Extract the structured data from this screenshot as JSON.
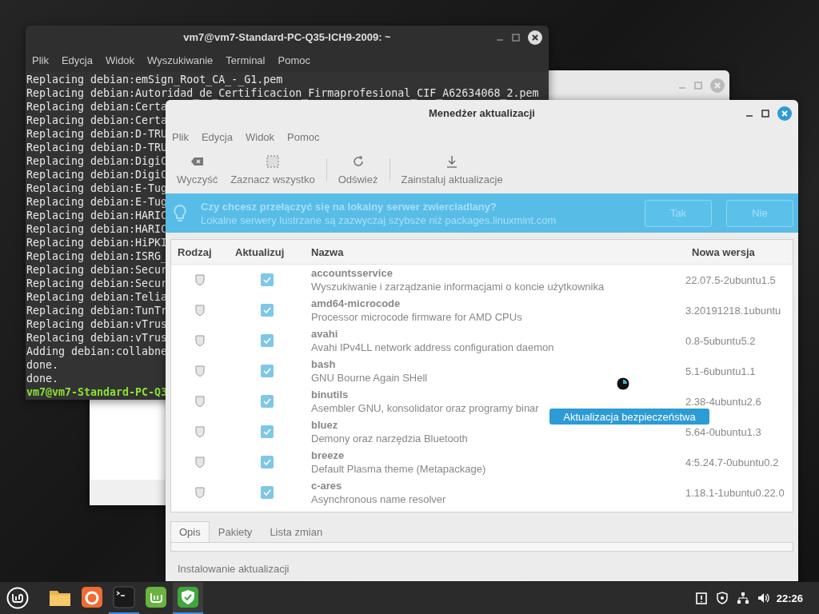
{
  "terminal": {
    "title": "vm7@vm7-Standard-PC-Q35-ICH9-2009: ~",
    "menu": [
      "Plik",
      "Edycja",
      "Widok",
      "Wyszukiwanie",
      "Terminal",
      "Pomoc"
    ],
    "lines": [
      {
        "kind": "output",
        "text": "Replacing debian:emSign_Root_CA_-_G1.pem"
      },
      {
        "kind": "output",
        "text": "Replacing debian:Autoridad_de_Certificacion_Firmaprofesional_CIF_A62634068_2.pem"
      },
      {
        "kind": "output",
        "text": "Replacing debian:Certa"
      },
      {
        "kind": "output",
        "text": "Replacing debian:Certa"
      },
      {
        "kind": "output",
        "text": "Replacing debian:D-TRU"
      },
      {
        "kind": "output",
        "text": "Replacing debian:D-TRU"
      },
      {
        "kind": "output",
        "text": "Replacing debian:DigiC"
      },
      {
        "kind": "output",
        "text": "Replacing debian:DigiC"
      },
      {
        "kind": "output",
        "text": "Replacing debian:E-Tug"
      },
      {
        "kind": "output",
        "text": "Replacing debian:E-Tug"
      },
      {
        "kind": "output",
        "text": "Replacing debian:HARIC"
      },
      {
        "kind": "output",
        "text": "Replacing debian:HARIC"
      },
      {
        "kind": "output",
        "text": "Replacing debian:HiPKI"
      },
      {
        "kind": "output",
        "text": "Replacing debian:ISRG_"
      },
      {
        "kind": "output",
        "text": "Replacing debian:Secur"
      },
      {
        "kind": "output",
        "text": "Replacing debian:Secur"
      },
      {
        "kind": "output",
        "text": "Replacing debian:Telia"
      },
      {
        "kind": "output",
        "text": "Replacing debian:TunTr"
      },
      {
        "kind": "output",
        "text": "Replacing debian:vTrus"
      },
      {
        "kind": "output",
        "text": "Replacing debian:vTrus"
      },
      {
        "kind": "output",
        "text": "Adding debian:collabne"
      },
      {
        "kind": "output",
        "text": "done."
      },
      {
        "kind": "output",
        "text": "done."
      },
      {
        "kind": "prompt",
        "text": "vm7@vm7-Standard-PC-Q3"
      }
    ]
  },
  "update_manager": {
    "title": "Menedżer aktualizacji",
    "menu": [
      "Plik",
      "Edycja",
      "Widok",
      "Pomoc"
    ],
    "toolbar": [
      [
        {
          "kind": "clear",
          "label": "Wyczyść"
        },
        {
          "kind": "select-all",
          "label": "Zaznacz wszystko"
        }
      ],
      [
        {
          "kind": "refresh",
          "label": "Odśwież"
        }
      ],
      [
        {
          "kind": "install",
          "label": "Zainstaluj aktualizacje"
        }
      ]
    ],
    "infobar": {
      "title": "Czy chcesz przełączyć się na lokalny serwer zwierciadlany?",
      "text": "Lokalne serwery lustrzane są zazwyczaj szybsze niż packages.linuxmint.com",
      "buttons": [
        "Tak",
        "Nie"
      ]
    },
    "table": {
      "columns": [
        "Rodzaj",
        "Aktualizuj",
        "Nazwa",
        "Nowa wersja"
      ],
      "rows": [
        {
          "kind": "security",
          "checked": true,
          "name": "accountsservice",
          "description": "Wyszukiwanie i zarządzanie informacjami o koncie użytkownika",
          "version": "22.07.5-2ubuntu1.5"
        },
        {
          "kind": "security",
          "checked": true,
          "name": "amd64-microcode",
          "description": "Processor microcode firmware for AMD CPUs",
          "version": "3.20191218.1ubuntu"
        },
        {
          "kind": "security",
          "checked": true,
          "name": "avahi",
          "description": "Avahi IPv4LL network address configuration daemon",
          "version": "0.8-5ubuntu5.2"
        },
        {
          "kind": "security",
          "checked": true,
          "name": "bash",
          "description": "GNU Bourne Again SHell",
          "version": "5.1-6ubuntu1.1"
        },
        {
          "kind": "security",
          "checked": true,
          "name": "binutils",
          "description": "Asembler GNU, konsolidator oraz programy binar",
          "version": "2.38-4ubuntu2.6"
        },
        {
          "kind": "security",
          "checked": true,
          "name": "bluez",
          "description": "Demony oraz narzędzia Bluetooth",
          "version": "5.64-0ubuntu1.3"
        },
        {
          "kind": "security",
          "checked": true,
          "name": "breeze",
          "description": "Default Plasma theme (Metapackage)",
          "version": "4:5.24.7-0ubuntu0.2"
        },
        {
          "kind": "security",
          "checked": true,
          "name": "c-ares",
          "description": "Asynchronous name resolver",
          "version": "1.18.1-1ubuntu0.22.0"
        }
      ]
    },
    "tooltip": "Aktualizacja bezpieczeństwa",
    "tabs": [
      {
        "label": "Opis",
        "selected": true
      },
      {
        "label": "Pakiety",
        "selected": false
      },
      {
        "label": "Lista zmian",
        "selected": false
      }
    ],
    "status": "Instalowanie aktualizacji"
  },
  "taskbar": {
    "apps": [
      {
        "kind": "files",
        "running": false,
        "selected": false
      },
      {
        "kind": "browser",
        "running": false,
        "selected": false
      },
      {
        "kind": "terminal",
        "running": true,
        "selected": false
      },
      {
        "kind": "mint",
        "running": false,
        "selected": false
      },
      {
        "kind": "shield",
        "running": true,
        "selected": true
      }
    ],
    "tray": [
      {
        "kind": "update"
      },
      {
        "kind": "shield"
      },
      {
        "kind": "network"
      },
      {
        "kind": "volume"
      }
    ],
    "clock": "22:26"
  }
}
